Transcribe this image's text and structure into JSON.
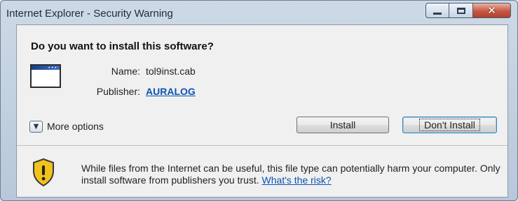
{
  "window": {
    "title": "Internet Explorer - Security Warning"
  },
  "dialog": {
    "question": "Do you want to install this software?",
    "name_label": "Name:",
    "name_value": "tol9inst.cab",
    "publisher_label": "Publisher:",
    "publisher_value": "AURALOG",
    "more_options": "More options",
    "install_button": "Install",
    "dont_install_button": "Don't Install",
    "warning_text": "While files from the Internet can be useful, this file type can potentially harm your computer. Only install software from publishers you trust.",
    "risk_link": "What's the risk?"
  },
  "icons": {
    "app": "application-window-icon",
    "shield": "security-shield-warning-icon",
    "expand": "chevron-down-icon"
  },
  "colors": {
    "link": "#0a53b0",
    "shield": "#f1c21b",
    "close": "#c65743"
  }
}
